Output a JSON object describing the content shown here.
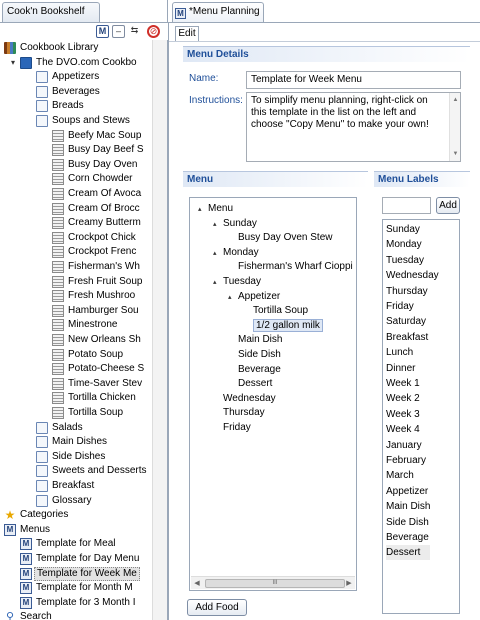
{
  "left_view": {
    "title": "Cook'n Bookshelf",
    "tree": [
      {
        "label": "Cookbook Library",
        "icon": "bookshelf-icon",
        "level": 0,
        "twisty": "▾"
      },
      {
        "label": "The DVO.com Cookbo",
        "icon": "cookbook-icon",
        "level": 1,
        "twisty": "▾"
      },
      {
        "label": "Appetizers",
        "icon": "chapter-icon",
        "level": 2,
        "twisty": ""
      },
      {
        "label": "Beverages",
        "icon": "chapter-icon",
        "level": 2,
        "twisty": ""
      },
      {
        "label": "Breads",
        "icon": "chapter-icon",
        "level": 2,
        "twisty": ""
      },
      {
        "label": "Soups and Stews",
        "icon": "chapter-icon",
        "level": 2,
        "twisty": ""
      },
      {
        "label": "Beefy Mac Soup",
        "icon": "recipe-icon",
        "level": 3,
        "twisty": ""
      },
      {
        "label": "Busy Day Beef S",
        "icon": "recipe-icon",
        "level": 3,
        "twisty": ""
      },
      {
        "label": "Busy Day Oven",
        "icon": "recipe-icon",
        "level": 3,
        "twisty": ""
      },
      {
        "label": "Corn Chowder",
        "icon": "recipe-icon",
        "level": 3,
        "twisty": ""
      },
      {
        "label": "Cream Of Avoca",
        "icon": "recipe-icon",
        "level": 3,
        "twisty": ""
      },
      {
        "label": "Cream Of Brocc",
        "icon": "recipe-icon",
        "level": 3,
        "twisty": ""
      },
      {
        "label": "Creamy Butterm",
        "icon": "recipe-icon",
        "level": 3,
        "twisty": ""
      },
      {
        "label": "Crockpot Chick",
        "icon": "recipe-icon",
        "level": 3,
        "twisty": ""
      },
      {
        "label": "Crockpot Frenc",
        "icon": "recipe-icon",
        "level": 3,
        "twisty": ""
      },
      {
        "label": "Fisherman's Wh",
        "icon": "recipe-icon",
        "level": 3,
        "twisty": ""
      },
      {
        "label": "Fresh Fruit Soup",
        "icon": "recipe-icon",
        "level": 3,
        "twisty": ""
      },
      {
        "label": "Fresh Mushroo",
        "icon": "recipe-icon",
        "level": 3,
        "twisty": ""
      },
      {
        "label": "Hamburger Sou",
        "icon": "recipe-icon",
        "level": 3,
        "twisty": ""
      },
      {
        "label": "Minestrone",
        "icon": "recipe-icon",
        "level": 3,
        "twisty": ""
      },
      {
        "label": "New Orleans Sh",
        "icon": "recipe-icon",
        "level": 3,
        "twisty": ""
      },
      {
        "label": "Potato Soup",
        "icon": "recipe-icon",
        "level": 3,
        "twisty": ""
      },
      {
        "label": "Potato-Cheese S",
        "icon": "recipe-icon",
        "level": 3,
        "twisty": ""
      },
      {
        "label": "Time-Saver Stev",
        "icon": "recipe-icon",
        "level": 3,
        "twisty": ""
      },
      {
        "label": "Tortilla Chicken",
        "icon": "recipe-icon",
        "level": 3,
        "twisty": ""
      },
      {
        "label": "Tortilla Soup",
        "icon": "recipe-icon",
        "level": 3,
        "twisty": ""
      },
      {
        "label": "Salads",
        "icon": "chapter-icon",
        "level": 2,
        "twisty": ""
      },
      {
        "label": "Main Dishes",
        "icon": "chapter-icon",
        "level": 2,
        "twisty": ""
      },
      {
        "label": "Side Dishes",
        "icon": "chapter-icon",
        "level": 2,
        "twisty": ""
      },
      {
        "label": "Sweets and Desserts",
        "icon": "chapter-icon",
        "level": 2,
        "twisty": ""
      },
      {
        "label": "Breakfast",
        "icon": "chapter-icon",
        "level": 2,
        "twisty": ""
      },
      {
        "label": "Glossary",
        "icon": "chapter-icon",
        "level": 2,
        "twisty": ""
      },
      {
        "label": "Categories",
        "icon": "star-icon",
        "level": 0,
        "twisty": ""
      },
      {
        "label": "Menus",
        "icon": "menu-icon",
        "level": 0,
        "twisty": "▾"
      },
      {
        "label": "Template for Meal",
        "icon": "menu-icon",
        "level": 1,
        "twisty": ""
      },
      {
        "label": "Template for Day Menu",
        "icon": "menu-icon",
        "level": 1,
        "twisty": ""
      },
      {
        "label": "Template for Week Me",
        "icon": "menu-icon",
        "level": 1,
        "twisty": "",
        "selected": true
      },
      {
        "label": "Template for Month M",
        "icon": "menu-icon",
        "level": 1,
        "twisty": ""
      },
      {
        "label": "Template for 3 Month I",
        "icon": "menu-icon",
        "level": 1,
        "twisty": ""
      },
      {
        "label": "Search",
        "icon": "search-icon",
        "level": 0,
        "twisty": ""
      }
    ]
  },
  "editor": {
    "tab_title": "*Menu Planning",
    "subtab": "Edit",
    "details": {
      "section_title": "Menu Details",
      "name_label": "Name:",
      "name_value": "Template for Week Menu",
      "instructions_label": "Instructions:",
      "instructions_value": "To simplify menu planning, right-click on this template in the list on the left and choose \"Copy Menu\" to make your own!"
    },
    "menu": {
      "section_title": "Menu",
      "items": [
        {
          "label": "Menu",
          "level": 0,
          "twisty": "▴"
        },
        {
          "label": "Sunday",
          "level": 1,
          "twisty": "▴"
        },
        {
          "label": "Busy Day Oven Stew",
          "level": 2,
          "twisty": ""
        },
        {
          "label": "Monday",
          "level": 1,
          "twisty": "▴"
        },
        {
          "label": "Fisherman's Wharf Cioppi",
          "level": 2,
          "twisty": ""
        },
        {
          "label": "Tuesday",
          "level": 1,
          "twisty": "▴"
        },
        {
          "label": "Appetizer",
          "level": 2,
          "twisty": "▴"
        },
        {
          "label": "Tortilla Soup",
          "level": 3,
          "twisty": ""
        },
        {
          "label": "1/2 gallon  milk",
          "level": 3,
          "twisty": "",
          "selected": true
        },
        {
          "label": "Main Dish",
          "level": 2,
          "twisty": ""
        },
        {
          "label": "Side Dish",
          "level": 2,
          "twisty": ""
        },
        {
          "label": "Beverage",
          "level": 2,
          "twisty": ""
        },
        {
          "label": "Dessert",
          "level": 2,
          "twisty": ""
        },
        {
          "label": "Wednesday",
          "level": 1,
          "twisty": ""
        },
        {
          "label": "Thursday",
          "level": 1,
          "twisty": ""
        },
        {
          "label": "Friday",
          "level": 1,
          "twisty": ""
        }
      ],
      "add_food_button": "Add Food",
      "hscroll_grip": "III"
    },
    "labels": {
      "section_title": "Menu Labels",
      "input_value": "",
      "add_button": "Add",
      "items": [
        "Sunday",
        "Monday",
        "Tuesday",
        "Wednesday",
        "Thursday",
        "Friday",
        "Saturday",
        "Breakfast",
        "Lunch",
        "Dinner",
        "Week 1",
        "Week 2",
        "Week 3",
        "Week 4",
        "January",
        "February",
        "March",
        "Appetizer",
        "Main Dish",
        "Side Dish",
        "Beverage",
        "Dessert"
      ],
      "selected_index": 21
    }
  },
  "colors": {
    "section_title": "#1f4f99",
    "border": "#9aa7b8"
  }
}
